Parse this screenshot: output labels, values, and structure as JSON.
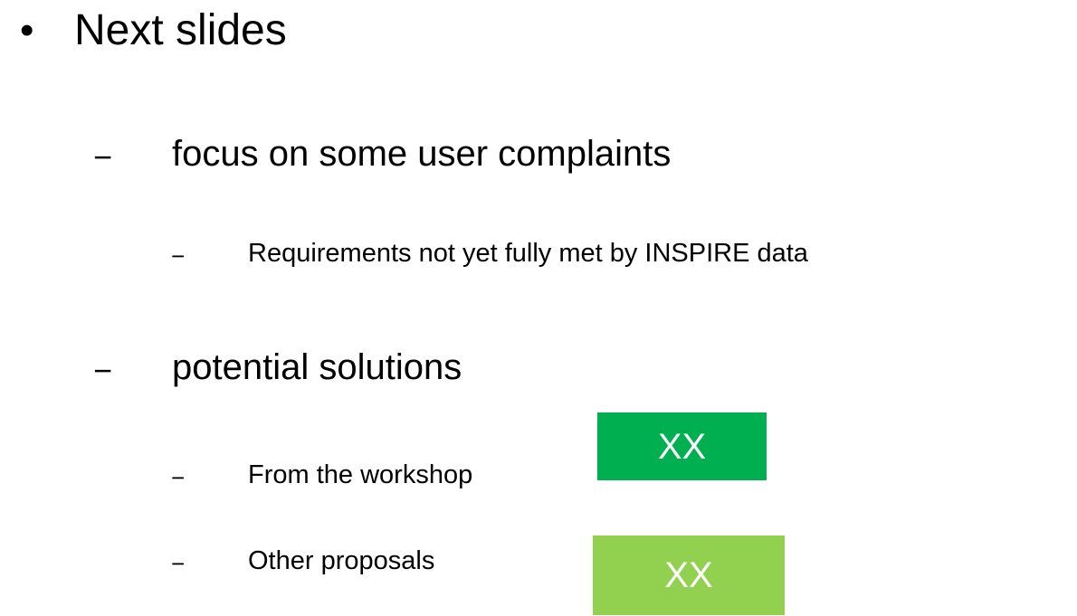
{
  "slide": {
    "heading": {
      "bullet": "•",
      "text": "Next slides"
    },
    "items": [
      {
        "dash": "−",
        "text": "focus on some user complaints"
      },
      {
        "dash": "−",
        "text": "Requirements not yet fully met by INSPIRE data"
      },
      {
        "dash": "−",
        "text": "potential solutions"
      },
      {
        "dash": "−",
        "text": "From the workshop"
      },
      {
        "dash": "−",
        "text": "Other proposals"
      }
    ],
    "badges": [
      {
        "label": "XX",
        "color": "#00AF50"
      },
      {
        "label": "XX",
        "color": "#92D050"
      }
    ]
  }
}
